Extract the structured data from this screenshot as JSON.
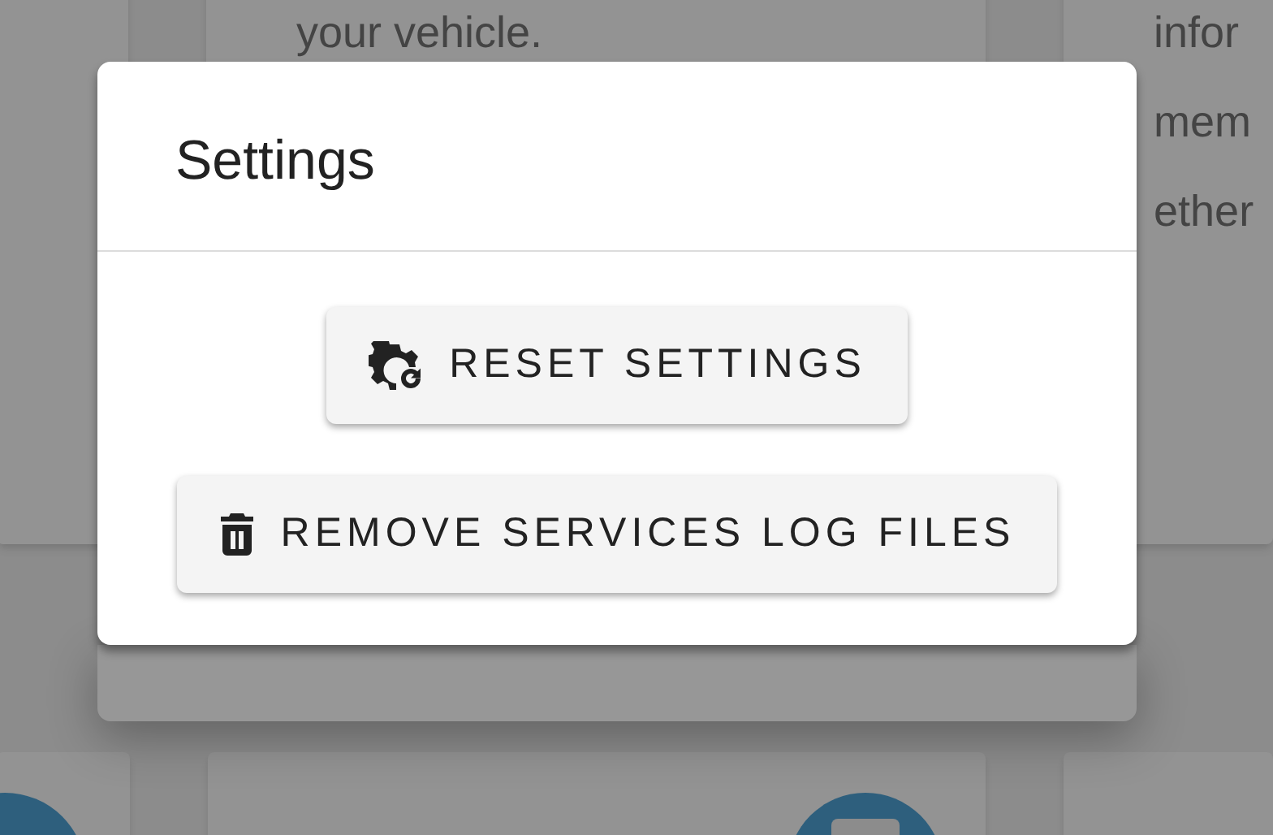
{
  "background_cards": [
    {
      "lines": [
        "your vehicle."
      ]
    },
    {
      "lines": [
        "infor",
        "mem",
        "ether"
      ]
    }
  ],
  "dialog": {
    "title": "Settings",
    "buttons": [
      {
        "label": "RESET SETTINGS",
        "kind": "reset"
      },
      {
        "label": "REMOVE SERVICES LOG FILES",
        "kind": "delete"
      }
    ]
  }
}
